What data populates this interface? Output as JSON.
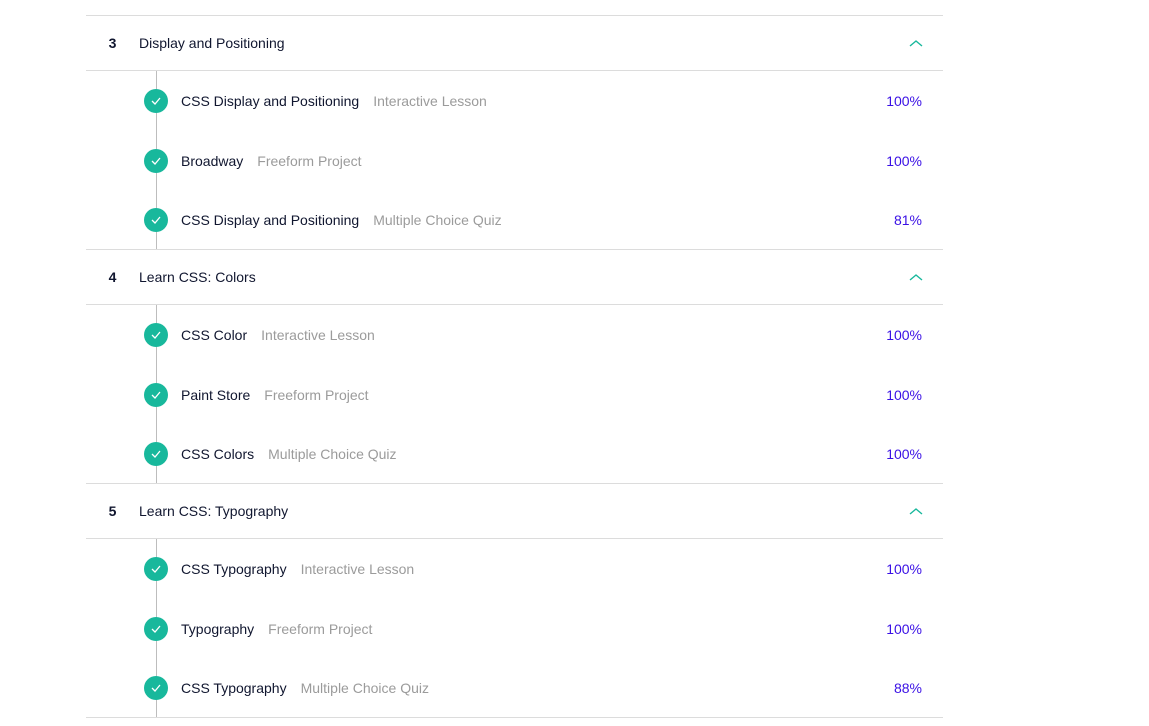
{
  "colors": {
    "accent_teal": "#18b89c",
    "score_purple": "#3a10e5",
    "text_dark": "#10162f",
    "text_muted": "#9b9b9b",
    "divider": "#dcdcdc"
  },
  "icons": {
    "module_toggle": "chevron-up-icon",
    "lesson_status": "check-circle-icon"
  },
  "modules": [
    {
      "number": "3",
      "title": "Display and Positioning",
      "lessons": [
        {
          "title": "CSS Display and Positioning",
          "type": "Interactive Lesson",
          "score": "100%"
        },
        {
          "title": "Broadway",
          "type": "Freeform Project",
          "score": "100%"
        },
        {
          "title": "CSS Display and Positioning",
          "type": "Multiple Choice Quiz",
          "score": "81%"
        }
      ]
    },
    {
      "number": "4",
      "title": "Learn CSS: Colors",
      "lessons": [
        {
          "title": "CSS Color",
          "type": "Interactive Lesson",
          "score": "100%"
        },
        {
          "title": "Paint Store",
          "type": "Freeform Project",
          "score": "100%"
        },
        {
          "title": "CSS Colors",
          "type": "Multiple Choice Quiz",
          "score": "100%"
        }
      ]
    },
    {
      "number": "5",
      "title": "Learn CSS: Typography",
      "lessons": [
        {
          "title": "CSS Typography",
          "type": "Interactive Lesson",
          "score": "100%"
        },
        {
          "title": "Typography",
          "type": "Freeform Project",
          "score": "100%"
        },
        {
          "title": "CSS Typography",
          "type": "Multiple Choice Quiz",
          "score": "88%"
        }
      ]
    }
  ]
}
